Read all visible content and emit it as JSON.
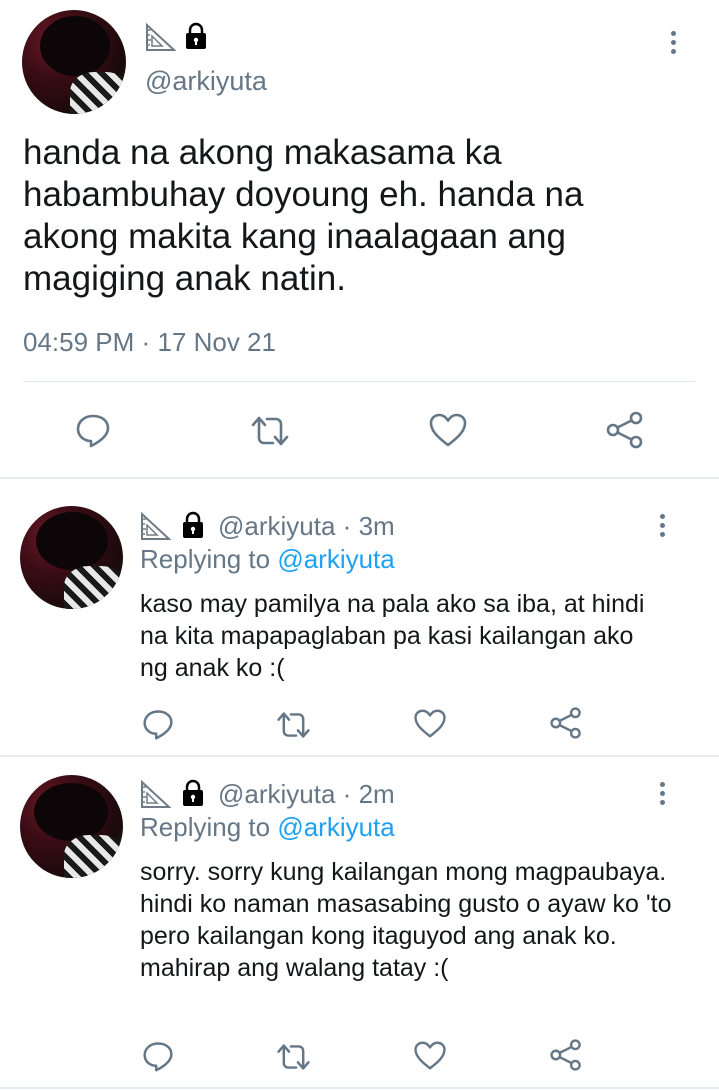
{
  "main_tweet": {
    "handle": "@arkiyuta",
    "text": "handa na akong makasama ka habambuhay doyoung eh. handa na akong makita kang inaalagaan ang magiging anak natin.",
    "time": "04:59 PM",
    "date": "17 Nov 21",
    "time_date_separator": "·"
  },
  "replies": [
    {
      "handle": "@arkiyuta",
      "age": "3m",
      "separator": "·",
      "replying_prefix": "Replying to",
      "replying_to": "@arkiyuta",
      "text": "kaso may pamilya na pala ako sa iba, at hindi na kita mapapaglaban pa kasi kailangan ako ng anak ko :("
    },
    {
      "handle": "@arkiyuta",
      "age": "2m",
      "separator": "·",
      "replying_prefix": "Replying to",
      "replying_to": "@arkiyuta",
      "text": "sorry. sorry kung kailangan mong magpaubaya. hindi ko naman masasabing gusto o ayaw ko 'to pero kailangan kong itaguyod ang anak ko. mahirap ang walang tatay :("
    }
  ],
  "icons": {
    "name_badge": "triangular-ruler-icon",
    "protected": "lock-icon",
    "actions": [
      "reply-icon",
      "retweet-icon",
      "like-icon",
      "share-icon"
    ]
  },
  "colors": {
    "text": "#14171a",
    "muted": "#657786",
    "link": "#1da1f2",
    "divider": "#e1e8ed"
  }
}
